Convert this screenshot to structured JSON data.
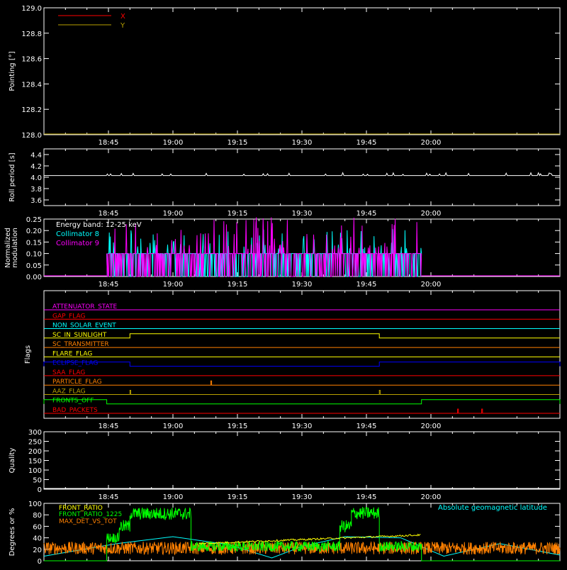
{
  "colors": {
    "background": "#000000",
    "axis": "#ffffff",
    "x_pointing": "#ff0000",
    "y_pointing": "#b8a000",
    "collimator8": "#00ffff",
    "collimator9": "#ff00ff",
    "front_ratio": "#ffff00",
    "front_ratio_1225": "#00ff00",
    "max_det_vs_tot": "#ff8000",
    "geomag_lat": "#00ffff"
  },
  "time_axis": {
    "start_min": 1110,
    "end_min": 1230,
    "ticks": [
      {
        "t": 1125,
        "label": "18:45"
      },
      {
        "t": 1140,
        "label": "19:00"
      },
      {
        "t": 1155,
        "label": "19:15"
      },
      {
        "t": 1170,
        "label": "19:30"
      },
      {
        "t": 1185,
        "label": "19:45"
      },
      {
        "t": 1200,
        "label": "20:00"
      }
    ]
  },
  "chart_data": [
    {
      "type": "line",
      "ylabel": "Pointing [°]",
      "ylim": [
        128.0,
        129.0
      ],
      "yticks": [
        "128.0",
        "128.2",
        "128.4",
        "128.6",
        "128.8",
        "129.0"
      ],
      "legend": [
        "X",
        "Y"
      ],
      "series": [
        {
          "name": "X",
          "x": [],
          "y": []
        },
        {
          "name": "Y",
          "x": [],
          "y": []
        }
      ]
    },
    {
      "type": "line",
      "ylabel": "Roll period [s]",
      "ylim": [
        3.5,
        4.5
      ],
      "yticks": [
        "3.6",
        "3.8",
        "4.0",
        "4.2",
        "4.4"
      ],
      "series": [
        {
          "x": [
            1110,
            1230
          ],
          "y": [
            4.03,
            4.03
          ]
        }
      ]
    },
    {
      "type": "line",
      "ylabel": "Normalized modulation",
      "ylim": [
        0.0,
        0.25
      ],
      "yticks": [
        "0.00",
        "0.05",
        "0.10",
        "0.15",
        "0.20",
        "0.25"
      ],
      "legend": [
        "Energy band: 12-25 keV",
        "Collimator 8",
        "Collimator 9"
      ],
      "active_range": [
        1124.6,
        1197.8
      ],
      "baseline": 0.1
    },
    {
      "type": "line",
      "ylabel": "Flags",
      "flags": [
        {
          "name": "ATTENUATOR_STATE",
          "color": "#ff00ff",
          "highs": []
        },
        {
          "name": "GAP_FLAG",
          "color": "#ff0000",
          "highs": []
        },
        {
          "name": "NON_SOLAR_EVENT",
          "color": "#00ffff",
          "highs": []
        },
        {
          "name": "SC_IN_SUNLIGHT",
          "color": "#ffff00",
          "highs": [
            [
              1130.0,
              1188.0
            ]
          ]
        },
        {
          "name": "SC_TRANSMITTER",
          "color": "#ff8000",
          "highs": []
        },
        {
          "name": "FLARE_FLAG",
          "color": "#ffff00",
          "highs": []
        },
        {
          "name": "ECLIPSE_FLAG",
          "color": "#0000ff",
          "highs": [
            [
              1110.0,
              1130.0
            ],
            [
              1188.0,
              1230.0
            ]
          ]
        },
        {
          "name": "SAA_FLAG",
          "color": "#ff0000",
          "highs": []
        },
        {
          "name": "PARTICLE_FLAG",
          "color": "#ff8000",
          "highs": [
            [
              1148.8,
              1149.0
            ]
          ]
        },
        {
          "name": "AAZ_FLAG",
          "color": "#b8a000",
          "highs": [
            [
              1130.0,
              1130.2
            ],
            [
              1188.0,
              1188.2
            ]
          ]
        },
        {
          "name": "FRONTS_OFF",
          "color": "#00ff00",
          "highs": [
            [
              1110.0,
              1124.6
            ],
            [
              1197.8,
              1230.0
            ]
          ]
        },
        {
          "name": "BAD_PACKETS",
          "color": "#ff0000",
          "highs": [
            [
              1206.2,
              1206.4
            ],
            [
              1211.8,
              1212.0
            ]
          ]
        }
      ]
    },
    {
      "type": "line",
      "ylabel": "Quality",
      "ylim": [
        0,
        300
      ],
      "yticks": [
        "0",
        "50",
        "100",
        "150",
        "200",
        "250",
        "300"
      ],
      "series": [
        {
          "x": [
            1110,
            1230
          ],
          "y": [
            0,
            0
          ]
        }
      ]
    },
    {
      "type": "line",
      "ylabel": "Degrees or %",
      "ylim": [
        0,
        100
      ],
      "yticks": [
        "0",
        "20",
        "40",
        "60",
        "80",
        "100"
      ],
      "legend": [
        "FRONT_RATIO",
        "FRONT_RATIO_1225",
        "MAX_DET_VS_TOT"
      ],
      "annotation": "Absolute geomagnetic latitude",
      "front_ratio_1225_segments": [
        {
          "x": [
            1110,
            1124.6
          ],
          "y": [
            0,
            0
          ]
        },
        {
          "x": [
            1124.6,
            1127.5
          ],
          "y": [
            40,
            40
          ]
        },
        {
          "x": [
            1127.5,
            1130.0
          ],
          "y": [
            60,
            60
          ]
        },
        {
          "x": [
            1130.0,
            1144.2
          ],
          "y": [
            82,
            82
          ]
        },
        {
          "x": [
            1144.2,
            1178.8
          ],
          "y": [
            25,
            25
          ]
        },
        {
          "x": [
            1178.8,
            1181.5
          ],
          "y": [
            60,
            60
          ]
        },
        {
          "x": [
            1181.5,
            1188.0
          ],
          "y": [
            83,
            83
          ]
        },
        {
          "x": [
            1188.0,
            1197.8
          ],
          "y": [
            25,
            25
          ]
        },
        {
          "x": [
            1197.8,
            1230
          ],
          "y": [
            0,
            0
          ]
        }
      ],
      "front_ratio_segment": {
        "x": [
          1146.0,
          1197.8
        ],
        "y": [
          30,
          45
        ]
      },
      "max_det_vs_tot_mean": 22,
      "geomag_lat": {
        "x": [
          1110,
          1127,
          1140,
          1153,
          1163,
          1170,
          1180,
          1193,
          1203,
          1216,
          1230
        ],
        "y": [
          8,
          30,
          42,
          28,
          5,
          25,
          42,
          40,
          8,
          30,
          10
        ]
      }
    }
  ]
}
